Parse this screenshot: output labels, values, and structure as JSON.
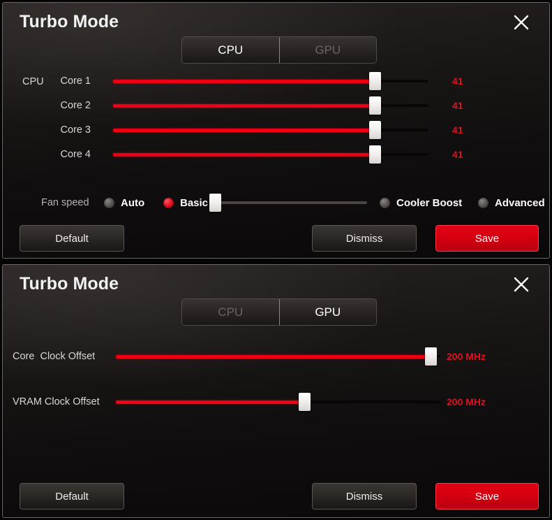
{
  "panels": [
    {
      "title": "Turbo Mode",
      "close_icon": "close-icon",
      "tabs": [
        {
          "label": "CPU",
          "active": true
        },
        {
          "label": "GPU",
          "active": false
        }
      ],
      "group_label": "CPU",
      "sliders": [
        {
          "label": "Core 1",
          "value": "41",
          "percent": 83
        },
        {
          "label": "Core 2",
          "value": "41",
          "percent": 83
        },
        {
          "label": "Core 3",
          "value": "41",
          "percent": 83
        },
        {
          "label": "Core 4",
          "value": "41",
          "percent": 83
        }
      ],
      "fan": {
        "label": "Fan speed",
        "options": [
          {
            "label": "Auto",
            "selected": false
          },
          {
            "label": "Basic",
            "selected": true
          },
          {
            "label": "Cooler Boost",
            "selected": false
          },
          {
            "label": "Advanced",
            "selected": false
          }
        ],
        "slider_percent": 2
      },
      "buttons": {
        "default_label": "Default",
        "dismiss_label": "Dismiss",
        "save_label": "Save"
      }
    },
    {
      "title": "Turbo Mode",
      "close_icon": "close-icon",
      "tabs": [
        {
          "label": "CPU",
          "active": false
        },
        {
          "label": "GPU",
          "active": true
        }
      ],
      "sliders": [
        {
          "label": "Core  Clock Offset",
          "value": "200 MHz",
          "percent": 97
        },
        {
          "label": "VRAM Clock Offset",
          "value": "200 MHz",
          "percent": 58
        }
      ],
      "buttons": {
        "default_label": "Default",
        "dismiss_label": "Dismiss",
        "save_label": "Save"
      }
    }
  ],
  "colors": {
    "accent_red": "#ee0014",
    "value_red": "#e2101f",
    "panel_border": "#6d6663",
    "text_primary": "#f2f2f2",
    "text_dim": "#6a6462"
  }
}
